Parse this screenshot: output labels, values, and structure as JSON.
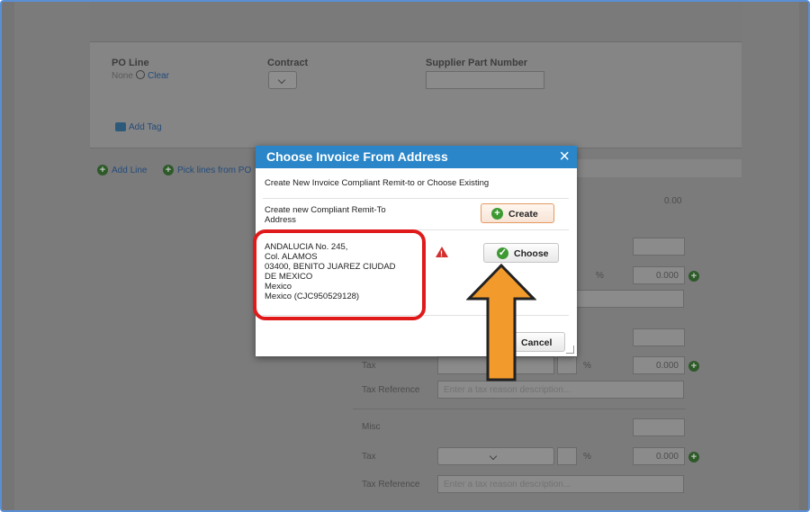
{
  "background": {
    "po_line": {
      "label": "PO Line",
      "value": "None",
      "clear_label": "Clear"
    },
    "contract": {
      "label": "Contract"
    },
    "supplier_part_number": {
      "label": "Supplier Part Number"
    },
    "add_tag_label": "Add Tag",
    "add_line_label": "Add Line",
    "pick_lines_label": "Pick lines from PO",
    "amount_value": "0.00",
    "percent_sign": "%",
    "tax_amount_1": "0.000",
    "tax_label": "Tax",
    "tax_reference_label": "Tax Reference",
    "tax_reference_placeholder": "Enter a tax reason description...",
    "tax_amount_2": "0.000",
    "misc_label": "Misc",
    "tax_amount_3": "0.000"
  },
  "modal": {
    "title": "Choose Invoice From Address",
    "close_icon": "×",
    "instruction": "Create New Invoice Compliant Remit-to or Choose Existing",
    "create_row_label_line1": "Create new Compliant Remit-To",
    "create_row_label_line2": "Address",
    "create_button_label": "Create",
    "address_lines": [
      "ANDALUCIA No. 245,",
      "Col. ALAMOS",
      "03400, BENITO JUAREZ CIUDAD",
      "DE MEXICO",
      "Mexico",
      "Mexico (CJC950529128)"
    ],
    "choose_button_label": "Choose",
    "cancel_button_label": "Cancel"
  },
  "colors": {
    "modal_header": "#2a86c8",
    "highlight_box": "#e01a1a",
    "arrow_fill": "#f39a2c",
    "success_green": "#3d9a33",
    "warning_red": "#d32f2f"
  }
}
